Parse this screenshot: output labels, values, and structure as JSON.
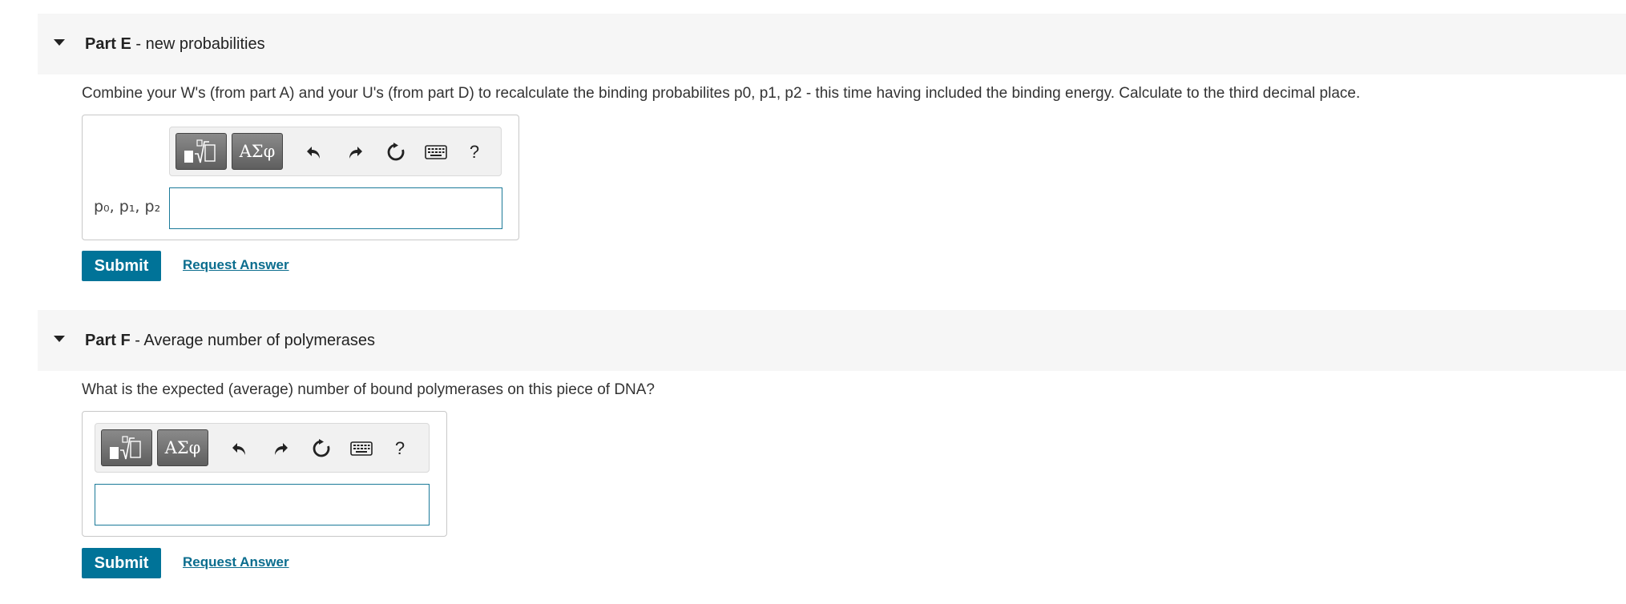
{
  "parts": [
    {
      "label": "Part E",
      "separator": " - ",
      "title": "new probabilities",
      "question": "Combine your W's (from part A) and your U's (from part D) to recalculate the binding probabilites p0, p1, p2 - this time having included the binding energy. Calculate to the third decimal place.",
      "answer_label": "p₀, p₁, p₂",
      "input_value": "",
      "submit_label": "Submit",
      "request_answer_label": "Request Answer"
    },
    {
      "label": "Part F",
      "separator": " - ",
      "title": "Average number of polymerases",
      "question": "What is the expected (average) number of bound polymerases on this piece of DNA?",
      "answer_label": "",
      "input_value": "",
      "submit_label": "Submit",
      "request_answer_label": "Request Answer"
    }
  ],
  "toolbar": {
    "templates_icon": "templates-icon",
    "symbols_label": "ΑΣφ",
    "undo_icon": "undo-icon",
    "redo_icon": "redo-icon",
    "reset_icon": "reset-icon",
    "keyboard_icon": "keyboard-icon",
    "help_label": "?"
  },
  "colors": {
    "accent": "#007398",
    "link": "#0b6d8e",
    "header_bg": "#f6f6f6",
    "input_border": "#1b7a99"
  }
}
